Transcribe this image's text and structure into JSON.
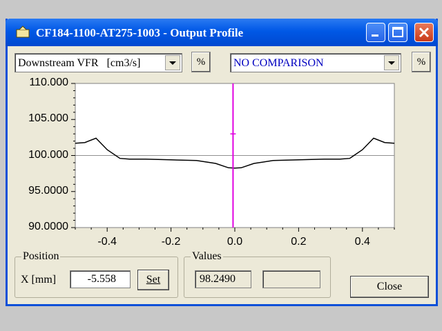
{
  "window": {
    "title": "CF184-1100-AT275-1003 - Output Profile"
  },
  "toolbar": {
    "quantity_select": "Downstream VFR   [cm3/s]",
    "percent_label_1": "%",
    "comparison_select": "NO COMPARISON",
    "percent_label_2": "%"
  },
  "colors": {
    "title_bar": "#0058e6",
    "cursor_line": "#e000e0",
    "comparison_text": "#0000c0",
    "profile_line": "#000000"
  },
  "chart_data": {
    "type": "line",
    "title": "",
    "xlabel": "",
    "ylabel": "",
    "xlim": [
      -0.5,
      0.5
    ],
    "ylim": [
      90,
      110
    ],
    "x_ticks": [
      "-0.4",
      "-0.2",
      "0.0",
      "0.2",
      "0.4"
    ],
    "x_tick_values": [
      -0.4,
      -0.2,
      0.0,
      0.2,
      0.4
    ],
    "y_ticks": [
      "110.000",
      "105.000",
      "100.000",
      "95.0000",
      "90.0000"
    ],
    "y_tick_values": [
      110,
      105,
      100,
      95,
      90
    ],
    "reference_line": 100,
    "cursor_x": -0.005558,
    "series": [
      {
        "x": [
          -0.5,
          -0.47,
          -0.435,
          -0.4,
          -0.36,
          -0.33,
          -0.28,
          -0.2,
          -0.12,
          -0.06,
          -0.02,
          0.0,
          0.02,
          0.06,
          0.12,
          0.2,
          0.28,
          0.33,
          0.36,
          0.4,
          0.435,
          0.47,
          0.5
        ],
        "y": [
          101.7,
          101.8,
          102.4,
          100.8,
          99.6,
          99.5,
          99.5,
          99.4,
          99.3,
          98.9,
          98.3,
          98.25,
          98.3,
          98.9,
          99.3,
          99.4,
          99.5,
          99.5,
          99.6,
          100.8,
          102.4,
          101.8,
          101.7
        ]
      }
    ]
  },
  "position": {
    "group_label": "Position",
    "x_label": "X [mm]",
    "x_value": "-5.558",
    "set_button": "Set"
  },
  "values": {
    "group_label": "Values",
    "value_1": "98.2490",
    "value_2": ""
  },
  "footer": {
    "close_button": "Close"
  }
}
